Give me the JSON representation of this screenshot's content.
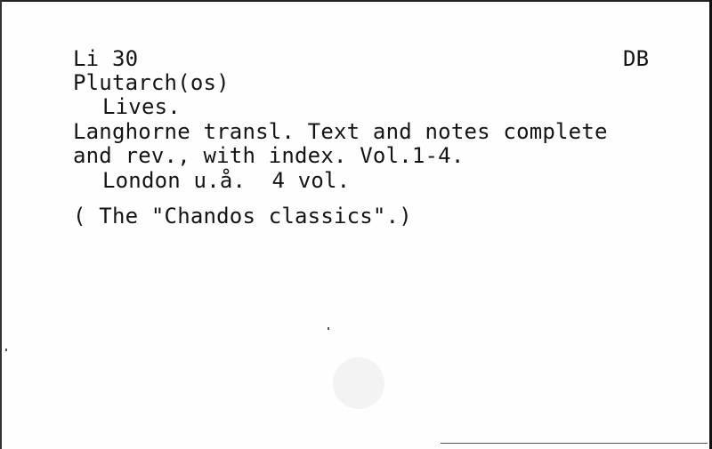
{
  "card": {
    "call_number": "Li 30",
    "location_code": "DB",
    "author": "Plutarch(os)",
    "title": "Lives.",
    "note_line1": "Langhorne transl. Text and notes complete",
    "note_line2": "and rev., with index. Vol.1-4.",
    "imprint": "London u.å.  4 vol.",
    "series": "( The \"Chandos classics\".)"
  }
}
